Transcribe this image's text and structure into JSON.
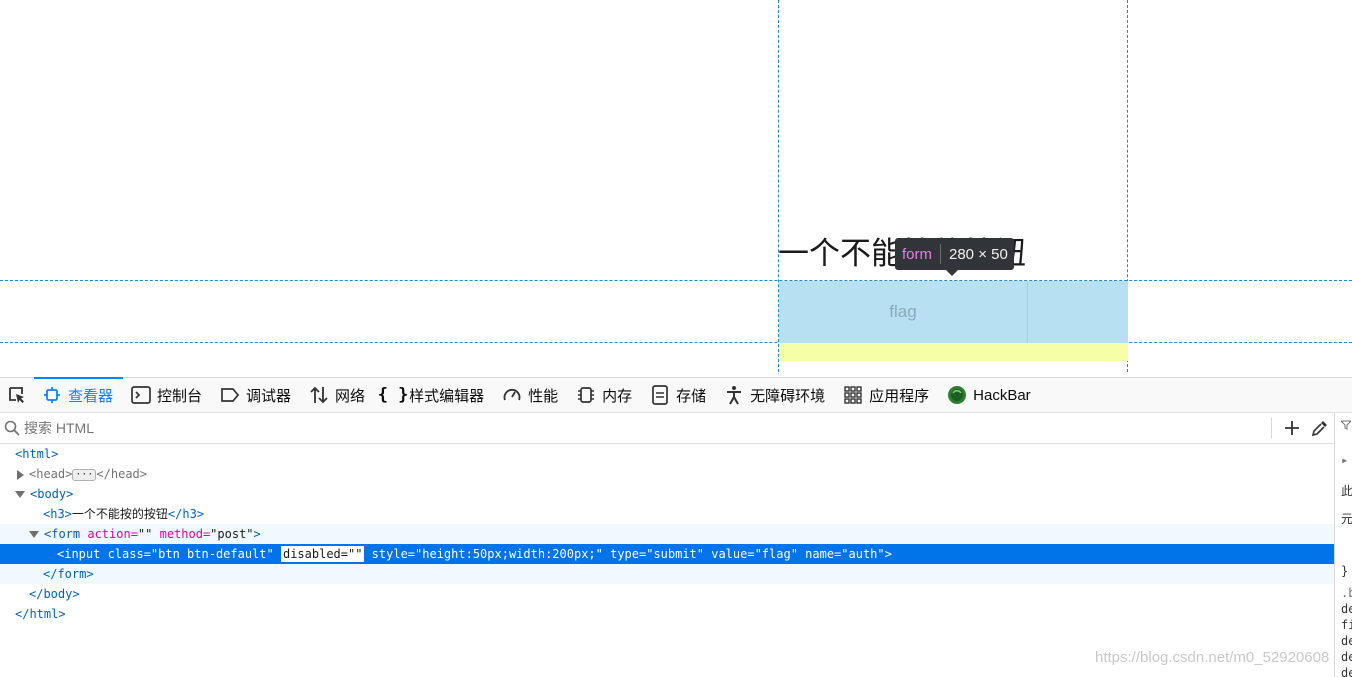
{
  "page": {
    "heading": "一个不能按的按钮",
    "button_value": "flag"
  },
  "highlighter": {
    "tag": "form",
    "dimensions": "280 × 50"
  },
  "toolbar": {
    "tabs": [
      {
        "label": "查看器",
        "icon": "inspector-icon"
      },
      {
        "label": "控制台",
        "icon": "console-icon"
      },
      {
        "label": "调试器",
        "icon": "debugger-icon"
      },
      {
        "label": "网络",
        "icon": "network-icon"
      },
      {
        "label": "样式编辑器",
        "icon": "style-editor-icon"
      },
      {
        "label": "性能",
        "icon": "performance-icon"
      },
      {
        "label": "内存",
        "icon": "memory-icon"
      },
      {
        "label": "存储",
        "icon": "storage-icon"
      },
      {
        "label": "无障碍环境",
        "icon": "accessibility-icon"
      },
      {
        "label": "应用程序",
        "icon": "application-icon"
      },
      {
        "label": "HackBar",
        "icon": "hackbar-icon"
      }
    ]
  },
  "search": {
    "placeholder": "搜索 HTML"
  },
  "markup": {
    "html_open": "<html>",
    "head_open": "<head>",
    "head_close": "</head>",
    "body_open": "<body>",
    "h3_open": "<h3>",
    "h3_text": "一个不能按的按钮",
    "h3_close": "</h3>",
    "form_open_start": "<form",
    "form_attr1_name": " action=",
    "form_attr1_val": "\"\"",
    "form_attr2_name": " method=",
    "form_attr2_val": "\"post\"",
    "form_open_end": ">",
    "input_prefix": "<input class=\"btn btn-default\" ",
    "input_disabled": "disabled=\"\"",
    "input_suffix": " style=\"height:50px;width:200px;\" type=\"submit\" value=\"flag\" name=\"auth\">",
    "form_close": "</form>",
    "body_close": "</body>",
    "html_close": "</html>"
  },
  "rightpane": {
    "lines": [
      "此",
      "元",
      "}",
      ".b",
      "de",
      "fi",
      "de",
      "de",
      "de"
    ]
  },
  "watermark": "https://blog.csdn.net/m0_52920608",
  "colors": {
    "accent": "#0a84ff",
    "selection": "#0074e8",
    "box_content": "#b8e0f3",
    "box_margin": "#f6ffa7"
  }
}
